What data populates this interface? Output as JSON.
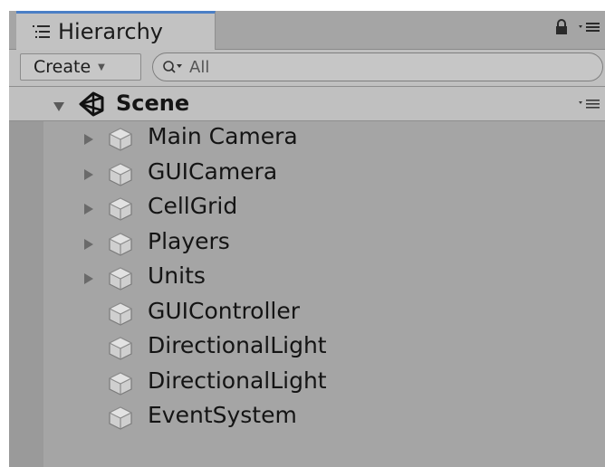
{
  "window": {
    "tab_title": "Hierarchy",
    "tab_icon": "hierarchy-list-icon",
    "lock_icon": "lock-icon",
    "menu_icon": "panel-menu-icon"
  },
  "toolbar": {
    "create_label": "Create",
    "create_caret": "▼",
    "search_placeholder": "All",
    "search_icon": "search-filter-icon"
  },
  "scene": {
    "label": "Scene",
    "expanded": true,
    "icon": "unity-logo-icon"
  },
  "items": [
    {
      "label": "Main Camera",
      "has_children": true
    },
    {
      "label": "GUICamera",
      "has_children": true
    },
    {
      "label": "CellGrid",
      "has_children": true
    },
    {
      "label": "Players",
      "has_children": true
    },
    {
      "label": "Units",
      "has_children": true
    },
    {
      "label": "GUIController",
      "has_children": false
    },
    {
      "label": "DirectionalLight",
      "has_children": false
    },
    {
      "label": "DirectionalLight",
      "has_children": false
    },
    {
      "label": "EventSystem",
      "has_children": false
    }
  ],
  "colors": {
    "panel_bg": "#a5a5a5",
    "header_bg": "#c0c0c0",
    "tab_accent": "#4a7fc6",
    "text": "#141414"
  }
}
